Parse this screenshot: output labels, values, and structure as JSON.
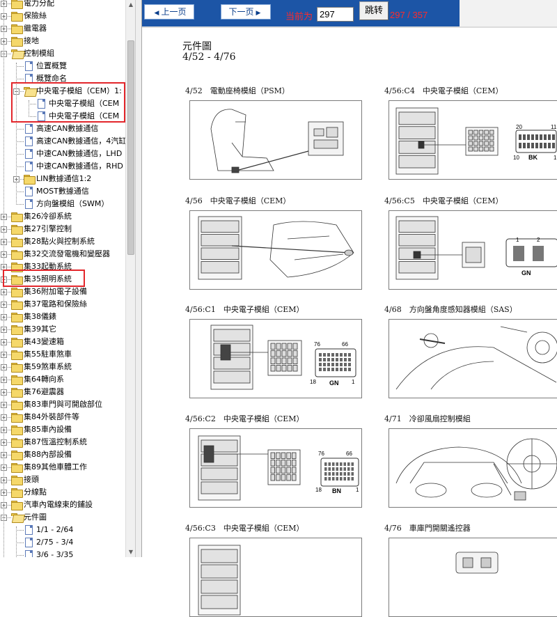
{
  "tree": {
    "items": [
      {
        "label": "電力分配",
        "icon": "folder-icon",
        "expander": "plus"
      },
      {
        "label": "保險絲",
        "icon": "folder-icon",
        "expander": "plus"
      },
      {
        "label": "繼電器",
        "icon": "folder-icon",
        "expander": "plus"
      },
      {
        "label": "接地",
        "icon": "folder-icon",
        "expander": "plus"
      },
      {
        "label": "控制模組",
        "icon": "folder-open-icon",
        "expander": "minus"
      },
      {
        "label": "位置概覽",
        "icon": "document-icon"
      },
      {
        "label": "概覽命名",
        "icon": "document-icon"
      },
      {
        "label": "中央電子模組（CEM）1:",
        "icon": "folder-open-icon",
        "expander": "minus"
      },
      {
        "label": "中央電子模組（CEM",
        "icon": "document-icon"
      },
      {
        "label": "中央電子模組（CEM",
        "icon": "document-icon"
      },
      {
        "label": "高速CAN數據通信",
        "icon": "document-icon"
      },
      {
        "label": "高速CAN數據通信，4汽缸",
        "icon": "document-icon"
      },
      {
        "label": "中速CAN數據通信，LHD",
        "icon": "document-icon"
      },
      {
        "label": "中速CAN數據通信，RHD",
        "icon": "document-icon"
      },
      {
        "label": "LIN數據通信1:2",
        "icon": "folder-icon",
        "expander": "plus"
      },
      {
        "label": "MOST數據通信",
        "icon": "document-icon"
      },
      {
        "label": "方向盤模組（SWM）",
        "icon": "document-icon"
      },
      {
        "label": "集26冷卻系統",
        "icon": "folder-icon",
        "expander": "plus"
      },
      {
        "label": "集27引擎控制",
        "icon": "folder-icon",
        "expander": "plus"
      },
      {
        "label": "集28點火與控制系統",
        "icon": "folder-icon",
        "expander": "plus"
      },
      {
        "label": "集32交流發電機和變壓器",
        "icon": "folder-icon",
        "expander": "plus"
      },
      {
        "label": "集33起動系統",
        "icon": "folder-icon",
        "expander": "plus"
      },
      {
        "label": "集35照明系統",
        "icon": "folder-icon",
        "expander": "plus"
      },
      {
        "label": "集36附加電子設備",
        "icon": "folder-icon",
        "expander": "plus"
      },
      {
        "label": "集37電路和保險絲",
        "icon": "folder-icon",
        "expander": "plus"
      },
      {
        "label": "集38儀錶",
        "icon": "folder-icon",
        "expander": "plus"
      },
      {
        "label": "集39其它",
        "icon": "folder-icon",
        "expander": "plus"
      },
      {
        "label": "集43變速箱",
        "icon": "folder-icon",
        "expander": "plus"
      },
      {
        "label": "集55駐車煞車",
        "icon": "folder-icon",
        "expander": "plus"
      },
      {
        "label": "集59煞車系統",
        "icon": "folder-icon",
        "expander": "plus"
      },
      {
        "label": "集64轉向系",
        "icon": "folder-icon",
        "expander": "plus"
      },
      {
        "label": "集76避震器",
        "icon": "folder-icon",
        "expander": "plus"
      },
      {
        "label": "集83車門與可開啟部位",
        "icon": "folder-icon",
        "expander": "plus"
      },
      {
        "label": "集84外裝部件等",
        "icon": "folder-icon",
        "expander": "plus"
      },
      {
        "label": "集85車內設備",
        "icon": "folder-icon",
        "expander": "plus"
      },
      {
        "label": "集87恆溫控制系統",
        "icon": "folder-icon",
        "expander": "plus"
      },
      {
        "label": "集88內部設備",
        "icon": "folder-icon",
        "expander": "plus"
      },
      {
        "label": "集89其他車體工作",
        "icon": "folder-icon",
        "expander": "plus"
      },
      {
        "label": "接頭",
        "icon": "folder-icon",
        "expander": "plus"
      },
      {
        "label": "分線點",
        "icon": "folder-icon",
        "expander": "plus"
      },
      {
        "label": "汽車內電線束的鋪設",
        "icon": "folder-icon",
        "expander": "plus"
      },
      {
        "label": "元件圖",
        "icon": "folder-open-icon",
        "expander": "minus"
      },
      {
        "label": "1/1 - 2/64",
        "icon": "document-icon"
      },
      {
        "label": "2/75 - 3/4",
        "icon": "document-icon"
      },
      {
        "label": "3/6 - 3/35",
        "icon": "document-icon"
      }
    ]
  },
  "toolbar": {
    "prev_label": "上一页",
    "next_label": "下一页",
    "current_label": "当前为",
    "page_value": "297",
    "jump_label": "跳转",
    "page_count": "297 / 357"
  },
  "content": {
    "title": "元件圖",
    "range": "4/52 - 4/76",
    "figures": [
      {
        "caption": "4/52　電動座椅模組（PSM）",
        "image_label": "psm-seat-illustration"
      },
      {
        "caption": "4/56:C4　中央電子模組（CEM）",
        "image_label": "cem-connector-c4-illustration",
        "connector_text": [
          "20",
          "11",
          "10",
          "1",
          "BK"
        ]
      },
      {
        "caption": "4/56　中央電子模組（CEM）",
        "image_label": "cem-location-illustration"
      },
      {
        "caption": "4/56:C5　中央電子模組（CEM）",
        "image_label": "cem-connector-c5-illustration",
        "connector_text": [
          "1",
          "2",
          "GN"
        ]
      },
      {
        "caption": "4/56:C1　中央電子模組（CEM）",
        "image_label": "cem-connector-c1-illustration",
        "connector_text": [
          "76",
          "66",
          "18",
          "1",
          "GN"
        ]
      },
      {
        "caption": "4/68　方向盤角度感知器模組（SAS）",
        "image_label": "sas-illustration"
      },
      {
        "caption": "4/56:C2　中央電子模組（CEM）",
        "image_label": "cem-connector-c2-illustration",
        "connector_text": [
          "76",
          "66",
          "18",
          "1",
          "BN"
        ]
      },
      {
        "caption": "4/71　冷卻風扇控制模組",
        "image_label": "cooling-fan-illustration"
      },
      {
        "caption": "4/56:C3　中央電子模組（CEM）",
        "image_label": "cem-connector-c3-illustration"
      },
      {
        "caption": "4/76　車庫門開關遙控器",
        "image_label": "garage-remote-illustration"
      }
    ]
  },
  "colors": {
    "toolbar_bg": "#1c55a6",
    "accent_red": "#ff2a2a",
    "highlight_box": "#e3262b"
  }
}
